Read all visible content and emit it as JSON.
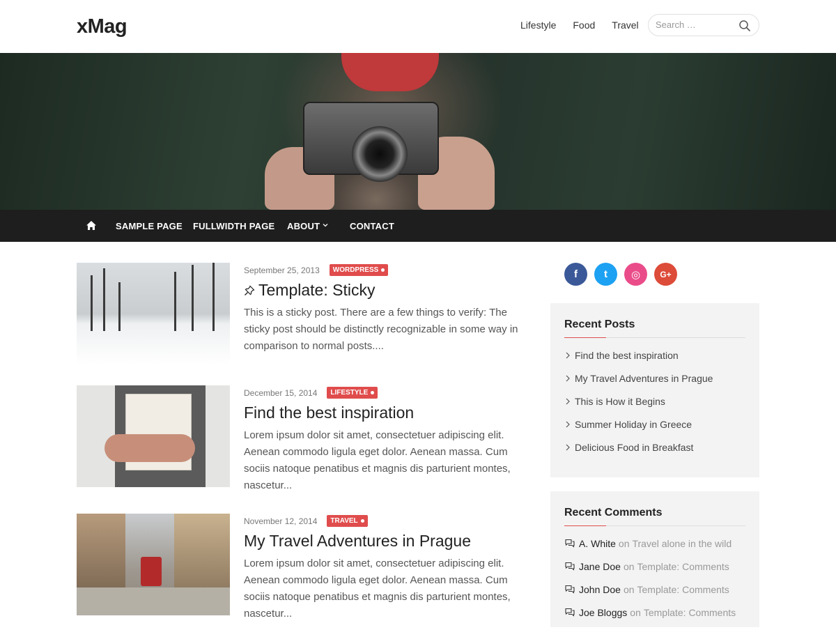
{
  "site": {
    "logo": "xMag"
  },
  "header": {
    "nav": [
      "Lifestyle",
      "Food",
      "Travel"
    ],
    "search": {
      "placeholder": "Search …"
    }
  },
  "main_nav": {
    "items": [
      {
        "label": "SAMPLE PAGE"
      },
      {
        "label": "FULLWIDTH PAGE"
      },
      {
        "label": "ABOUT",
        "has_dropdown": true
      },
      {
        "label": "CONTACT"
      }
    ]
  },
  "posts": [
    {
      "date": "September 25, 2013",
      "category": "WORDPRESS",
      "title": "Template: Sticky",
      "sticky": true,
      "excerpt": "This is a sticky post. There are a few things to verify: The sticky post should be distinctly recognizable in some way in comparison to normal posts...."
    },
    {
      "date": "December 15, 2014",
      "category": "LIFESTYLE",
      "title": "Find the best inspiration",
      "sticky": false,
      "excerpt": "Lorem ipsum dolor sit amet, consectetuer adipiscing elit. Aenean commodo ligula eget dolor. Aenean massa. Cum sociis natoque penatibus et magnis dis parturient montes, nascetur..."
    },
    {
      "date": "November 12, 2014",
      "category": "TRAVEL",
      "title": "My Travel Adventures in Prague",
      "sticky": false,
      "excerpt": "Lorem ipsum dolor sit amet, consectetuer adipiscing elit. Aenean commodo ligula eget dolor. Aenean massa. Cum sociis natoque penatibus et magnis dis parturient montes, nascetur..."
    }
  ],
  "sidebar": {
    "social": [
      {
        "icon": "facebook-icon",
        "glyph": "f",
        "color": "#3b5998"
      },
      {
        "icon": "twitter-icon",
        "glyph": "t",
        "color": "#1da1f2"
      },
      {
        "icon": "dribbble-icon",
        "glyph": "◎",
        "color": "#ea4c89"
      },
      {
        "icon": "google-plus-icon",
        "glyph": "G+",
        "color": "#dd4b39"
      }
    ],
    "recent_posts": {
      "title": "Recent Posts",
      "items": [
        "Find the best inspiration",
        "My Travel Adventures in Prague",
        "This is How it Begins",
        "Summer Holiday in Greece",
        "Delicious Food in Breakfast"
      ]
    },
    "recent_comments": {
      "title": "Recent Comments",
      "items": [
        {
          "author": "A. White",
          "on": "on",
          "post": "Travel alone in the wild"
        },
        {
          "author": "Jane Doe",
          "on": "on",
          "post": "Template: Comments"
        },
        {
          "author": "John Doe",
          "on": "on",
          "post": "Template: Comments"
        },
        {
          "author": "Joe Bloggs",
          "on": "on",
          "post": "Template: Comments"
        }
      ]
    }
  },
  "colors": {
    "accent": "#e04c4c",
    "nav_bg": "#1e1e1e"
  }
}
